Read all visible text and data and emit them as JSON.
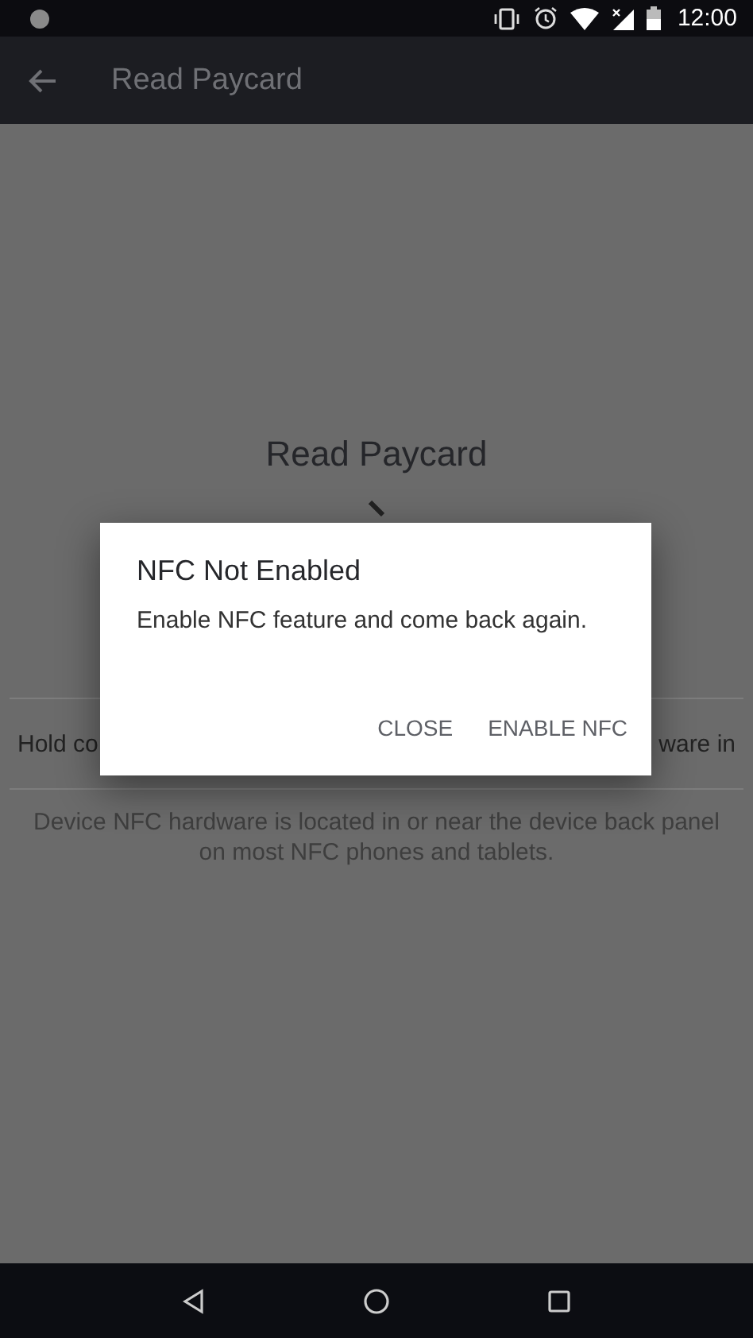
{
  "status_bar": {
    "time": "12:00"
  },
  "app_bar": {
    "title": "Read Paycard"
  },
  "content": {
    "heading": "Read Paycard",
    "instruction_left": "Hold co",
    "instruction_right": "ware in",
    "hint": "Device NFC hardware is located in or near the device back panel on most NFC phones and tablets."
  },
  "dialog": {
    "title": "NFC Not Enabled",
    "message": "Enable NFC feature and come back again.",
    "buttons": [
      "CLOSE",
      "ENABLE NFC"
    ]
  }
}
